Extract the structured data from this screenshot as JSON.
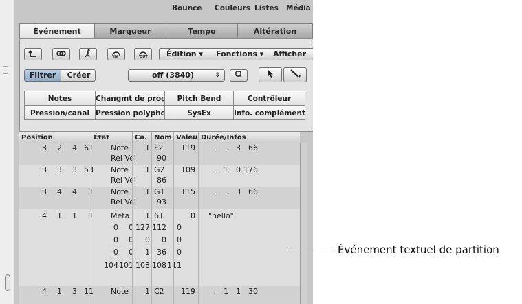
{
  "menubar": {
    "items": [
      "Bounce",
      "Couleurs",
      "Listes",
      "Média"
    ]
  },
  "tabs": [
    {
      "label": "Événement",
      "active": true
    },
    {
      "label": "Marqueur",
      "active": false
    },
    {
      "label": "Tempo",
      "active": false
    },
    {
      "label": "Altération",
      "active": false
    }
  ],
  "toolbar": {
    "icons": [
      "back-arrow-icon",
      "link-icon",
      "running-figure-icon",
      "midi-in-icon",
      "midi-out-icon"
    ],
    "edition_menu": "Édition",
    "fonctions_menu": "Fonctions",
    "afficher_menu": "Afficher"
  },
  "mode": {
    "filtrer": "Filtrer",
    "creer": "Créer"
  },
  "quantize": {
    "value": "off (3840)"
  },
  "filters": [
    [
      "Notes",
      "Changmt de prog.",
      "Pitch Bend",
      "Contrôleur"
    ],
    [
      "Pression/canal",
      "Pression polyphon",
      "SysEx",
      "Info. complémenta"
    ]
  ],
  "list_headers": [
    "Position",
    "État",
    "Ca.",
    "Nom",
    "Valeu",
    "Durée/Infos"
  ],
  "rows": [
    {
      "pos": [
        "3",
        "2",
        "4",
        "61"
      ],
      "state": "Note",
      "ch": "1",
      "name": "F2",
      "val": "119",
      "dur": [
        ".",
        ".",
        "3",
        "66"
      ],
      "sub_state": "Rel Vel",
      "sub_name": "90"
    },
    {
      "pos": [
        "3",
        "3",
        "3",
        "53"
      ],
      "state": "Note",
      "ch": "1",
      "name": "G2",
      "val": "109",
      "dur": [
        ".",
        "1",
        "0",
        "176"
      ],
      "sub_state": "Rel Vel",
      "sub_name": "86"
    },
    {
      "pos": [
        "3",
        "4",
        "4",
        "1"
      ],
      "state": "Note",
      "ch": "1",
      "name": "G1",
      "val": "115",
      "dur": [
        ".",
        ".",
        "3",
        "66"
      ],
      "sub_state": "Rel Vel",
      "sub_name": "93"
    },
    {
      "pos": [
        "4",
        "1",
        "1",
        "1"
      ],
      "state": "Meta",
      "ch": "1",
      "name": "61",
      "val": "0",
      "info": "\"hello\""
    },
    {
      "pos": [
        "4",
        "1",
        "3",
        "11"
      ],
      "state": "Note",
      "ch": "1",
      "name": "C2",
      "val": "119",
      "dur": [
        ".",
        "1",
        "1",
        "30"
      ]
    }
  ],
  "meta_bytes": [
    [
      "0",
      "0",
      "127",
      "112",
      "0"
    ],
    [
      "0",
      "0",
      "0",
      "0",
      "0"
    ],
    [
      "0",
      "0",
      "1",
      "36",
      "0"
    ],
    [
      "104",
      "101",
      "108",
      "108",
      "111"
    ]
  ],
  "callout": {
    "label": "Événement textuel de partition"
  }
}
